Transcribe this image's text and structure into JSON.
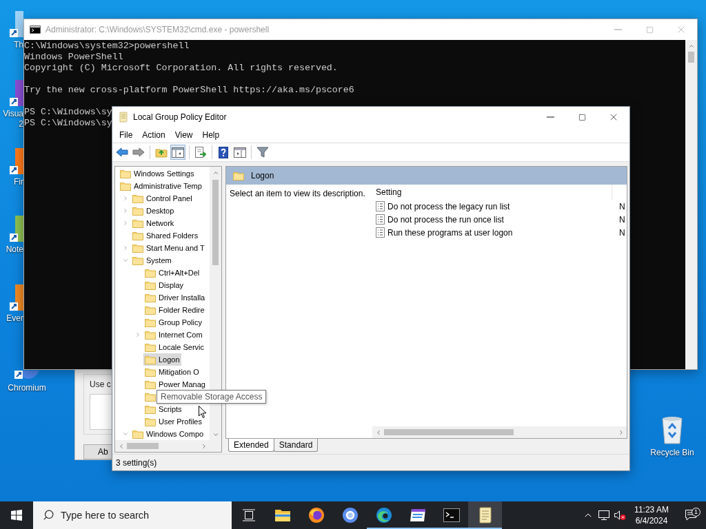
{
  "desktop_icons": [
    {
      "label": "Th"
    },
    {
      "label": "Visua 2"
    },
    {
      "label": "Fir"
    },
    {
      "label": "Note"
    },
    {
      "label": "Ever"
    },
    {
      "label": "Chromium"
    },
    {
      "label": "Recycle Bin"
    }
  ],
  "background_dialog": {
    "group_label": "Use c",
    "button": "Ab"
  },
  "console_window": {
    "title": "Administrator: C:\\Windows\\SYSTEM32\\cmd.exe - powershell",
    "active": false,
    "lines": [
      {
        "text": "C:\\Windows\\system32>powershell",
        "gap_before": false
      },
      {
        "text": "Windows PowerShell",
        "gap_before": false
      },
      {
        "text": "Copyright (C) Microsoft Corporation. All rights reserved.",
        "gap_before": false
      },
      {
        "text": "Try the new cross-platform PowerShell https://aka.ms/pscore6",
        "gap_before": true
      },
      {
        "text": "PS C:\\Windows\\sy",
        "gap_before": true
      },
      {
        "text": "PS C:\\Windows\\sy",
        "gap_before": false
      }
    ]
  },
  "editor_window": {
    "title": "Local Group Policy Editor",
    "active": true,
    "menu": [
      "File",
      "Action",
      "View",
      "Help"
    ],
    "toolbar": [
      {
        "pressed": false
      },
      {
        "pressed": false
      },
      {
        "pressed": false
      },
      {
        "pressed": true
      },
      {
        "pressed": false
      },
      {
        "pressed": false
      },
      {
        "pressed": false
      },
      {
        "pressed": false
      }
    ],
    "tree": [
      {
        "label": "Windows Settings",
        "selected": false
      },
      {
        "label": "Administrative Temp",
        "selected": false,
        "children": [
          {
            "label": "Control Panel",
            "expanded": false,
            "selected": false
          },
          {
            "label": "Desktop",
            "expanded": false,
            "selected": false
          },
          {
            "label": "Network",
            "expanded": false,
            "selected": false
          },
          {
            "label": "Shared Folders",
            "selected": false
          },
          {
            "label": "Start Menu and T",
            "expanded": false,
            "selected": false
          },
          {
            "label": "System",
            "expanded": true,
            "selected": false,
            "children": [
              {
                "label": "Ctrl+Alt+Del",
                "selected": false
              },
              {
                "label": "Display",
                "selected": false
              },
              {
                "label": "Driver Installa",
                "selected": false
              },
              {
                "label": "Folder Redire",
                "selected": false
              },
              {
                "label": "Group Policy",
                "selected": false
              },
              {
                "label": "Internet Com",
                "expanded": false,
                "selected": false
              },
              {
                "label": "Locale Servic",
                "selected": false
              },
              {
                "label": "Logon",
                "selected": true
              },
              {
                "label": "Mitigation O",
                "selected": false
              },
              {
                "label": "Power Manag",
                "selected": false
              },
              {
                "selected": false
              },
              {
                "label": "Scripts",
                "selected": false
              },
              {
                "label": "User Profiles",
                "selected": false
              }
            ]
          },
          {
            "label": "Windows Compo",
            "expanded": true,
            "selected": false
          }
        ]
      }
    ],
    "tooltip": "Removable Storage Access",
    "details": {
      "heading": "Logon",
      "description": "Select an item to view its description.",
      "columns": [
        "Setting"
      ],
      "rows": [
        {
          "setting": "Do not process the legacy run list",
          "column_2": "N"
        },
        {
          "setting": "Do not process the run once list",
          "column_2": "N"
        },
        {
          "setting": "Run these programs at user logon",
          "column_2": "N"
        }
      ]
    },
    "tabs": [
      {
        "label": "Extended",
        "selected": true
      },
      {
        "label": "Standard",
        "selected": false
      }
    ],
    "status_bar": "3 setting(s)"
  },
  "taskbar": {
    "search": {
      "placeholder": "Type here to search"
    },
    "apps": [
      {
        "running": false,
        "active": false
      },
      {
        "running": false,
        "active": false
      },
      {
        "running": false,
        "active": false
      },
      {
        "running": true,
        "active": false
      },
      {
        "running": true,
        "active": false
      },
      {
        "running": true,
        "active": false
      },
      {
        "running": true,
        "active": true
      }
    ],
    "clock": {
      "time": "11:23 AM",
      "date": "6/4/2024"
    },
    "notifications": "1"
  }
}
